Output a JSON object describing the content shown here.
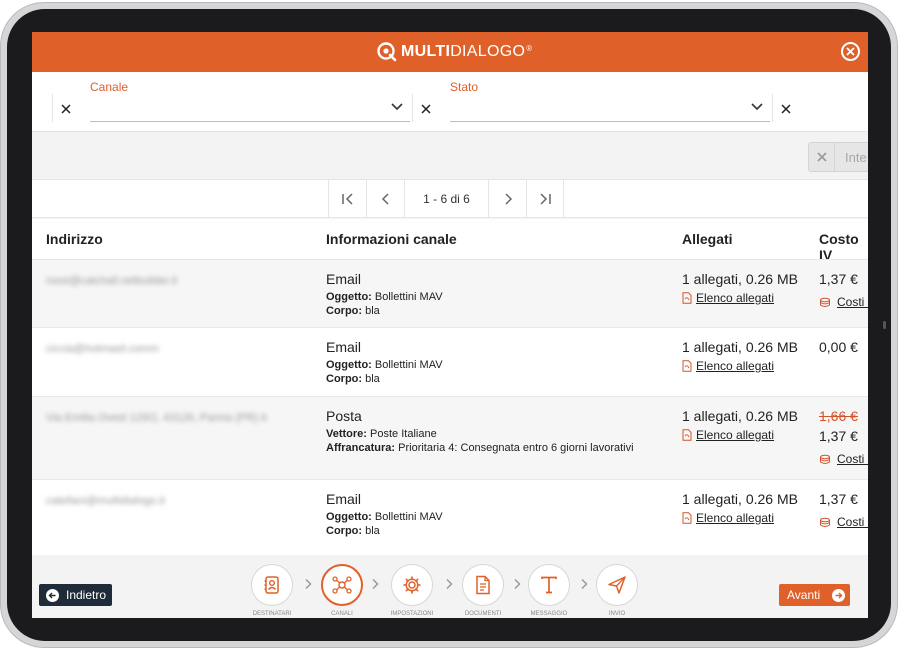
{
  "brand": {
    "name_bold": "MULTI",
    "name_light": "DIALOGO",
    "reg": "®"
  },
  "filters": {
    "canale": {
      "label": "Canale",
      "value": ""
    },
    "stato": {
      "label": "Stato",
      "value": ""
    }
  },
  "toolbar": {
    "partial_button_label": "Inte"
  },
  "pager": {
    "range_text": "1 - 6 di 6"
  },
  "table": {
    "headers": {
      "indirizzo": "Indirizzo",
      "info": "Informazioni canale",
      "allegati": "Allegati",
      "costo": "Costo IV"
    },
    "rows": [
      {
        "address": "rossi@catchall.netbuilder.it",
        "type": "Email",
        "lines": [
          {
            "k": "Oggetto:",
            "v": "Bollettini MAV"
          },
          {
            "k": "Corpo:",
            "v": "bla"
          }
        ],
        "attachments": "1 allegati, 0.26 MB",
        "attachments_link": "Elenco allegati",
        "cost_old": "",
        "cost": "1,37 €",
        "cost_link": "Costi i"
      },
      {
        "address": "ciccia@hotmasil.comm",
        "type": "Email",
        "lines": [
          {
            "k": "Oggetto:",
            "v": "Bollettini MAV"
          },
          {
            "k": "Corpo:",
            "v": "bla"
          }
        ],
        "attachments": "1 allegati, 0.26 MB",
        "attachments_link": "Elenco allegati",
        "cost_old": "",
        "cost": "0,00 €",
        "cost_link": ""
      },
      {
        "address": "Via Emilia Ovest 129/2, 43126, Parma (PR) it",
        "type": "Posta",
        "lines": [
          {
            "k": "Vettore:",
            "v": "Poste Italiane"
          },
          {
            "k": "Affrancatura:",
            "v": "Prioritaria 4: Consegnata entro 6 giorni lavorativi"
          }
        ],
        "attachments": "1 allegati, 0.26 MB",
        "attachments_link": "Elenco allegati",
        "cost_old": "1,66 €",
        "cost": "1,37 €",
        "cost_link": "Costi i"
      },
      {
        "address": "catellani@multidialogo.it",
        "type": "Email",
        "lines": [
          {
            "k": "Oggetto:",
            "v": "Bollettini MAV"
          },
          {
            "k": "Corpo:",
            "v": "bla"
          }
        ],
        "attachments": "1 allegati, 0.26 MB",
        "attachments_link": "Elenco allegati",
        "cost_old": "",
        "cost": "1,37 €",
        "cost_link": "Costi i"
      }
    ]
  },
  "footer": {
    "back_label": "Indietro",
    "next_label": "Avanti",
    "steps": [
      {
        "icon": "contacts-icon",
        "label": "DESTINATARI"
      },
      {
        "icon": "channels-icon",
        "label": "CANALI"
      },
      {
        "icon": "gear-icon",
        "label": "IMPOSTAZIONI"
      },
      {
        "icon": "document-icon",
        "label": "DOCUMENTI"
      },
      {
        "icon": "text-icon",
        "label": "MESSAGGIO"
      },
      {
        "icon": "send-icon",
        "label": "INVIO"
      }
    ]
  },
  "colors": {
    "accent": "#e0602a",
    "dark": "#1f2b38"
  }
}
